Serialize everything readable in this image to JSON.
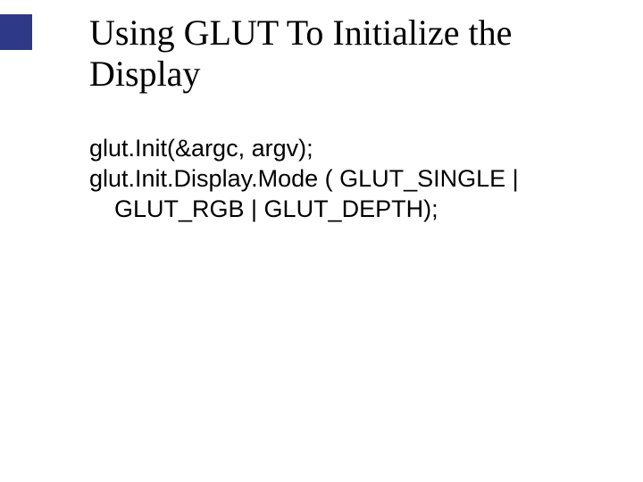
{
  "title": "Using GLUT To Initialize the Display",
  "body": {
    "line1": "glut.Init(&argc, argv);",
    "line2": "glut.Init.Display.Mode ( GLUT_SINGLE |",
    "line3": "GLUT_RGB | GLUT_DEPTH);"
  }
}
